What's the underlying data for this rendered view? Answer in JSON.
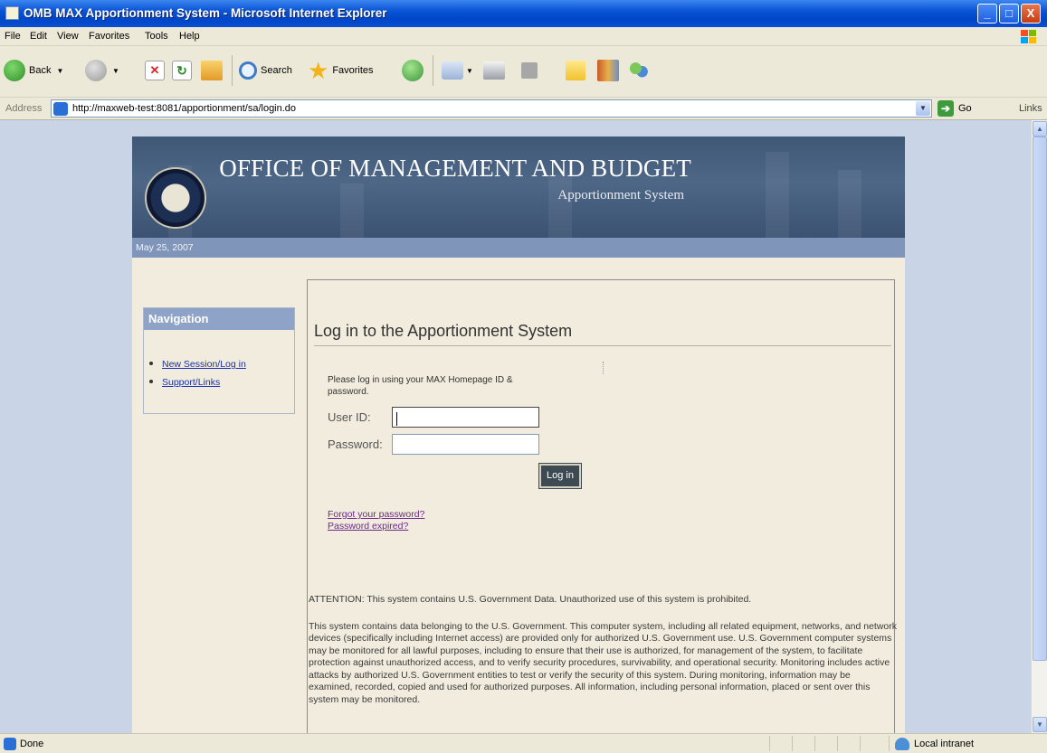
{
  "window": {
    "title": "OMB MAX Apportionment System - Microsoft Internet Explorer",
    "controls": {
      "minimize": "_",
      "maximize": "□",
      "close": "X"
    }
  },
  "menu": [
    "File",
    "Edit",
    "View",
    "Favorites",
    "Tools",
    "Help"
  ],
  "toolbar": {
    "back_label": "Back",
    "search_label": "Search",
    "favorites_label": "Favorites",
    "icons": [
      "back-icon",
      "forward-icon",
      "stop-icon",
      "refresh-icon",
      "home-icon",
      "search-icon",
      "favorites-icon",
      "history-icon",
      "mail-icon",
      "print-icon",
      "edit-icon",
      "notes-icon",
      "research-icon",
      "messenger-icon"
    ]
  },
  "address": {
    "label": "Address",
    "url": "http://maxweb-test:8081/apportionment/sa/login.do",
    "go_label": "Go",
    "links_label": "Links"
  },
  "header": {
    "org": "OFFICE OF MANAGEMENT AND BUDGET",
    "system": "Apportionment System",
    "date": "May 25, 2007"
  },
  "navigation": {
    "title": "Navigation",
    "items": [
      {
        "label": "New Session/Log in"
      },
      {
        "label": "Support/Links"
      }
    ]
  },
  "login": {
    "title": "Log in to the Apportionment System",
    "instructions": "Please log in using your MAX Homepage ID & password.",
    "user_label": "User ID:",
    "user_value": "",
    "password_label": "Password:",
    "password_value": "",
    "button": "Log in",
    "forgot_link": "Forgot your password?",
    "expired_link": "Password expired?"
  },
  "warning": {
    "attention": "ATTENTION: This system contains U.S. Government Data. Unauthorized use of this system is prohibited.",
    "body": "This system contains data belonging to the U.S. Government. This computer system, including all related equipment, networks, and network devices (specifically including Internet access) are provided only for authorized U.S. Government use. U.S. Government computer systems may be monitored for all lawful purposes, including to ensure that their use is authorized, for management of the system, to facilitate protection against unauthorized access, and to verify security procedures, survivability, and operational security. Monitoring includes active attacks by authorized U.S. Government entities to test or verify the security of this system. During monitoring, information may be examined, recorded, copied and used for authorized purposes. All information, including personal information, placed or sent over this system may be monitored."
  },
  "status": {
    "text": "Done",
    "zone": "Local intranet"
  },
  "colors": {
    "titlebar": "#0a54d6",
    "chrome": "#ece9d8",
    "page_bg": "#c9d4e6",
    "banner": "#4e6787",
    "nav_header": "#8ea3c7",
    "content_bg": "#f1ecdd",
    "link": "#1b2fa8",
    "visited_link": "#6b2a8a"
  }
}
